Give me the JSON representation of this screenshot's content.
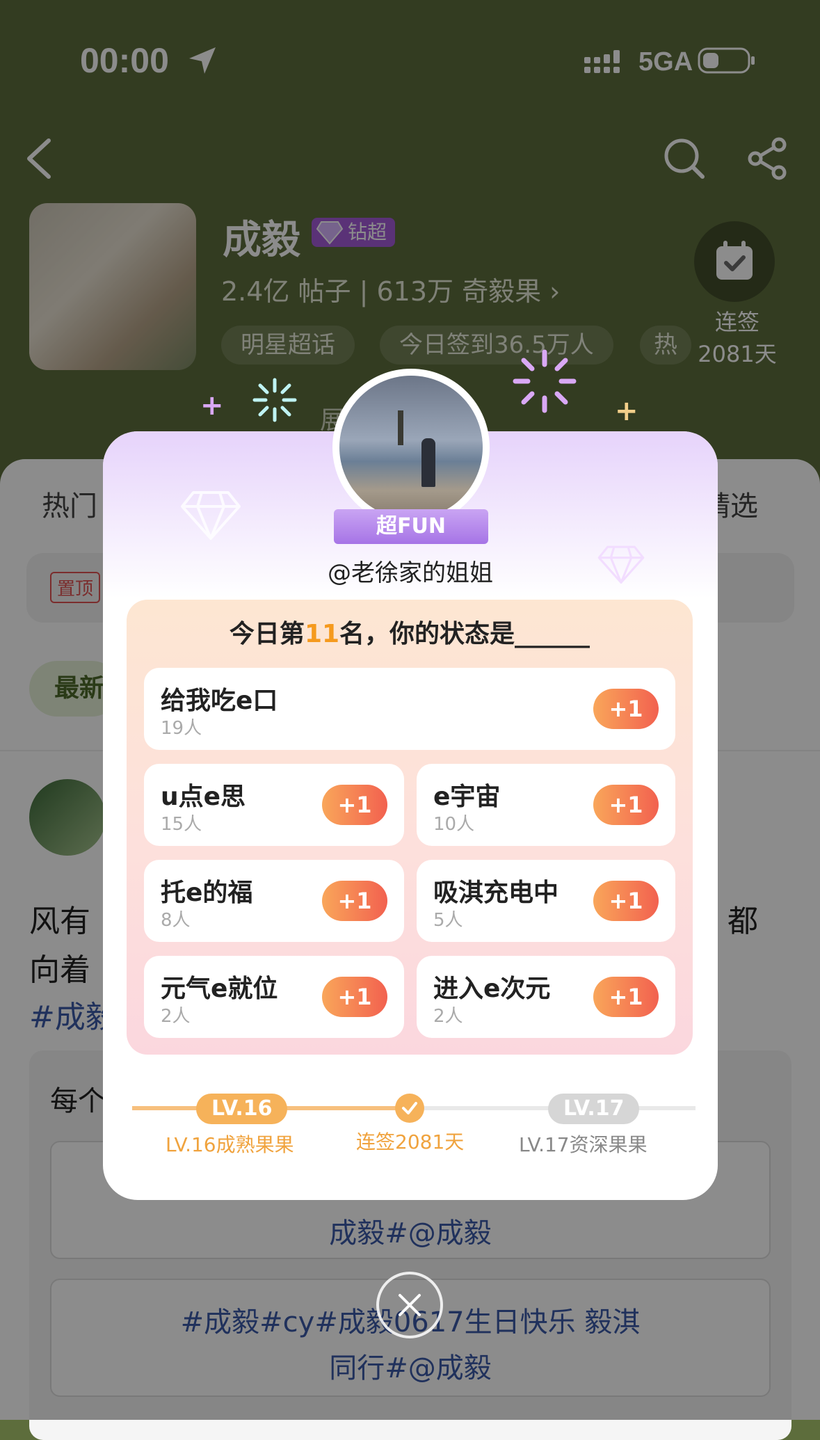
{
  "status_bar": {
    "time": "00:00",
    "network": "5GA"
  },
  "header": {
    "name": "成毅",
    "badge": "钻超",
    "stats": "2.4亿 帖子 | 613万 奇毅果 ›",
    "tags": [
      "明星超话",
      "今日签到36.5万人",
      "热"
    ],
    "checkin_label": "连签",
    "checkin_days": "2081天",
    "expand": "展"
  },
  "background": {
    "tab_hot": "热门",
    "tab_select": "精选",
    "pinned": "置顶",
    "latest": "最新",
    "post_text_1": "风有",
    "post_text_1b": "都",
    "post_text_2": "向着",
    "post_tag": "#成毅",
    "box_prefix": "每个",
    "btn1": "成毅#@成毅",
    "btn2_line1": "#成毅#cy#成毅0617生日快乐 毅淇",
    "btn2_line2": "同行#@成毅"
  },
  "modal": {
    "ribbon": "超FUN",
    "username": "@老徐家的姐姐",
    "title_pre": "今日第",
    "rank": "11",
    "title_post": "名，你的状态是______",
    "plus_label": "+1",
    "options": [
      {
        "label": "给我吃e口",
        "count": "19人"
      },
      {
        "label": "u点e思",
        "count": "15人"
      },
      {
        "label": "e宇宙",
        "count": "10人"
      },
      {
        "label": "托e的福",
        "count": "8人"
      },
      {
        "label": "吸淇充电中",
        "count": "5人"
      },
      {
        "label": "元气e就位",
        "count": "2人"
      },
      {
        "label": "进入e次元",
        "count": "2人"
      }
    ],
    "progress": {
      "current_level": "LV.16",
      "current_caption": "LV.16成熟果果",
      "middle_caption": "连签2081天",
      "next_level": "LV.17",
      "next_caption": "LV.17资深果果"
    }
  },
  "colors": {
    "header_bg": "#5d6d3c",
    "accent_orange": "#f59a1e",
    "plus_gradient_end": "#f2614f",
    "badge_purple": "#a45cd9"
  }
}
